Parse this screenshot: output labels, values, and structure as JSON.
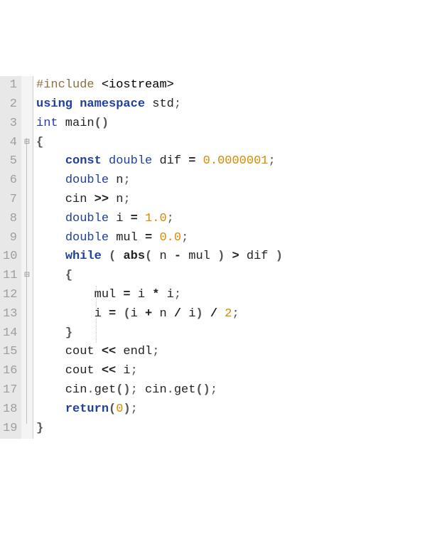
{
  "editor": {
    "lines": [
      {
        "n": "1",
        "fold": "",
        "tokens": [
          [
            "preproc",
            "#include "
          ],
          [
            "include-str",
            "<iostream>"
          ]
        ]
      },
      {
        "n": "2",
        "fold": "",
        "tokens": [
          [
            "kw",
            "using"
          ],
          [
            "ident",
            " "
          ],
          [
            "kw",
            "namespace"
          ],
          [
            "ident",
            " std"
          ],
          [
            "semicolon",
            ";"
          ]
        ]
      },
      {
        "n": "3",
        "fold": "",
        "tokens": [
          [
            "kw-plain",
            "int"
          ],
          [
            "ident",
            " main"
          ],
          [
            "punct-bold",
            "()"
          ]
        ]
      },
      {
        "n": "4",
        "fold": "⊟",
        "tokens": [
          [
            "brace",
            "{"
          ]
        ]
      },
      {
        "n": "5",
        "fold": "│",
        "tokens": [
          [
            "ident",
            "    "
          ],
          [
            "kw",
            "const"
          ],
          [
            "ident",
            " "
          ],
          [
            "kw-plain",
            "double"
          ],
          [
            "ident",
            " dif "
          ],
          [
            "op",
            "="
          ],
          [
            "ident",
            " "
          ],
          [
            "num",
            "0.0000001"
          ],
          [
            "semicolon",
            ";"
          ]
        ]
      },
      {
        "n": "6",
        "fold": "│",
        "tokens": [
          [
            "ident",
            "    "
          ],
          [
            "kw-plain",
            "double"
          ],
          [
            "ident",
            " n"
          ],
          [
            "semicolon",
            ";"
          ]
        ]
      },
      {
        "n": "7",
        "fold": "│",
        "tokens": [
          [
            "ident",
            "    cin "
          ],
          [
            "op",
            ">>"
          ],
          [
            "ident",
            " n"
          ],
          [
            "semicolon",
            ";"
          ]
        ]
      },
      {
        "n": "8",
        "fold": "│",
        "tokens": [
          [
            "ident",
            "    "
          ],
          [
            "kw-plain",
            "double"
          ],
          [
            "ident",
            " i "
          ],
          [
            "op",
            "="
          ],
          [
            "ident",
            " "
          ],
          [
            "num",
            "1.0"
          ],
          [
            "semicolon",
            ";"
          ]
        ]
      },
      {
        "n": "9",
        "fold": "│",
        "tokens": [
          [
            "ident",
            "    "
          ],
          [
            "kw-plain",
            "double"
          ],
          [
            "ident",
            " mul "
          ],
          [
            "op",
            "="
          ],
          [
            "ident",
            " "
          ],
          [
            "num",
            "0.0"
          ],
          [
            "semicolon",
            ";"
          ]
        ]
      },
      {
        "n": "10",
        "fold": "│",
        "tokens": [
          [
            "ident",
            "    "
          ],
          [
            "kw",
            "while"
          ],
          [
            "ident",
            " "
          ],
          [
            "punct-bold",
            "("
          ],
          [
            "ident",
            " "
          ],
          [
            "func-bold",
            "abs"
          ],
          [
            "punct-bold",
            "("
          ],
          [
            "ident",
            " n "
          ],
          [
            "op",
            "-"
          ],
          [
            "ident",
            " mul "
          ],
          [
            "punct-bold",
            ")"
          ],
          [
            "ident",
            " "
          ],
          [
            "op",
            ">"
          ],
          [
            "ident",
            " dif "
          ],
          [
            "punct-bold",
            ")"
          ]
        ]
      },
      {
        "n": "11",
        "fold": "⊟",
        "tokens": [
          [
            "ident",
            "    "
          ],
          [
            "brace",
            "{"
          ]
        ]
      },
      {
        "n": "12",
        "fold": "│",
        "tokens": [
          [
            "ident",
            "        mul "
          ],
          [
            "op",
            "="
          ],
          [
            "ident",
            " i "
          ],
          [
            "op",
            "*"
          ],
          [
            "ident",
            " i"
          ],
          [
            "semicolon",
            ";"
          ]
        ]
      },
      {
        "n": "13",
        "fold": "│",
        "tokens": [
          [
            "ident",
            "        i "
          ],
          [
            "op",
            "="
          ],
          [
            "ident",
            " "
          ],
          [
            "punct-bold",
            "("
          ],
          [
            "ident",
            "i "
          ],
          [
            "op",
            "+"
          ],
          [
            "ident",
            " n "
          ],
          [
            "op",
            "/"
          ],
          [
            "ident",
            " i"
          ],
          [
            "punct-bold",
            ")"
          ],
          [
            "ident",
            " "
          ],
          [
            "op",
            "/"
          ],
          [
            "ident",
            " "
          ],
          [
            "num",
            "2"
          ],
          [
            "semicolon",
            ";"
          ]
        ]
      },
      {
        "n": "14",
        "fold": "│",
        "tokens": [
          [
            "ident",
            "    "
          ],
          [
            "brace",
            "}"
          ]
        ]
      },
      {
        "n": "15",
        "fold": "│",
        "tokens": [
          [
            "ident",
            "    cout "
          ],
          [
            "op",
            "<<"
          ],
          [
            "ident",
            " endl"
          ],
          [
            "semicolon",
            ";"
          ]
        ]
      },
      {
        "n": "16",
        "fold": "│",
        "tokens": [
          [
            "ident",
            "    cout "
          ],
          [
            "op",
            "<<"
          ],
          [
            "ident",
            " i"
          ],
          [
            "semicolon",
            ";"
          ]
        ]
      },
      {
        "n": "17",
        "fold": "│",
        "tokens": [
          [
            "ident",
            "    cin"
          ],
          [
            "punct",
            "."
          ],
          [
            "ident",
            "get"
          ],
          [
            "punct-bold",
            "()"
          ],
          [
            "semicolon",
            ";"
          ],
          [
            "ident",
            " cin"
          ],
          [
            "punct",
            "."
          ],
          [
            "ident",
            "get"
          ],
          [
            "punct-bold",
            "()"
          ],
          [
            "semicolon",
            ";"
          ]
        ]
      },
      {
        "n": "18",
        "fold": "│",
        "tokens": [
          [
            "ident",
            "    "
          ],
          [
            "kw",
            "return"
          ],
          [
            "punct-bold",
            "("
          ],
          [
            "num",
            "0"
          ],
          [
            "punct-bold",
            ")"
          ],
          [
            "semicolon",
            ";"
          ]
        ]
      },
      {
        "n": "19",
        "fold": "",
        "tokens": [
          [
            "brace",
            "}"
          ]
        ]
      }
    ]
  }
}
